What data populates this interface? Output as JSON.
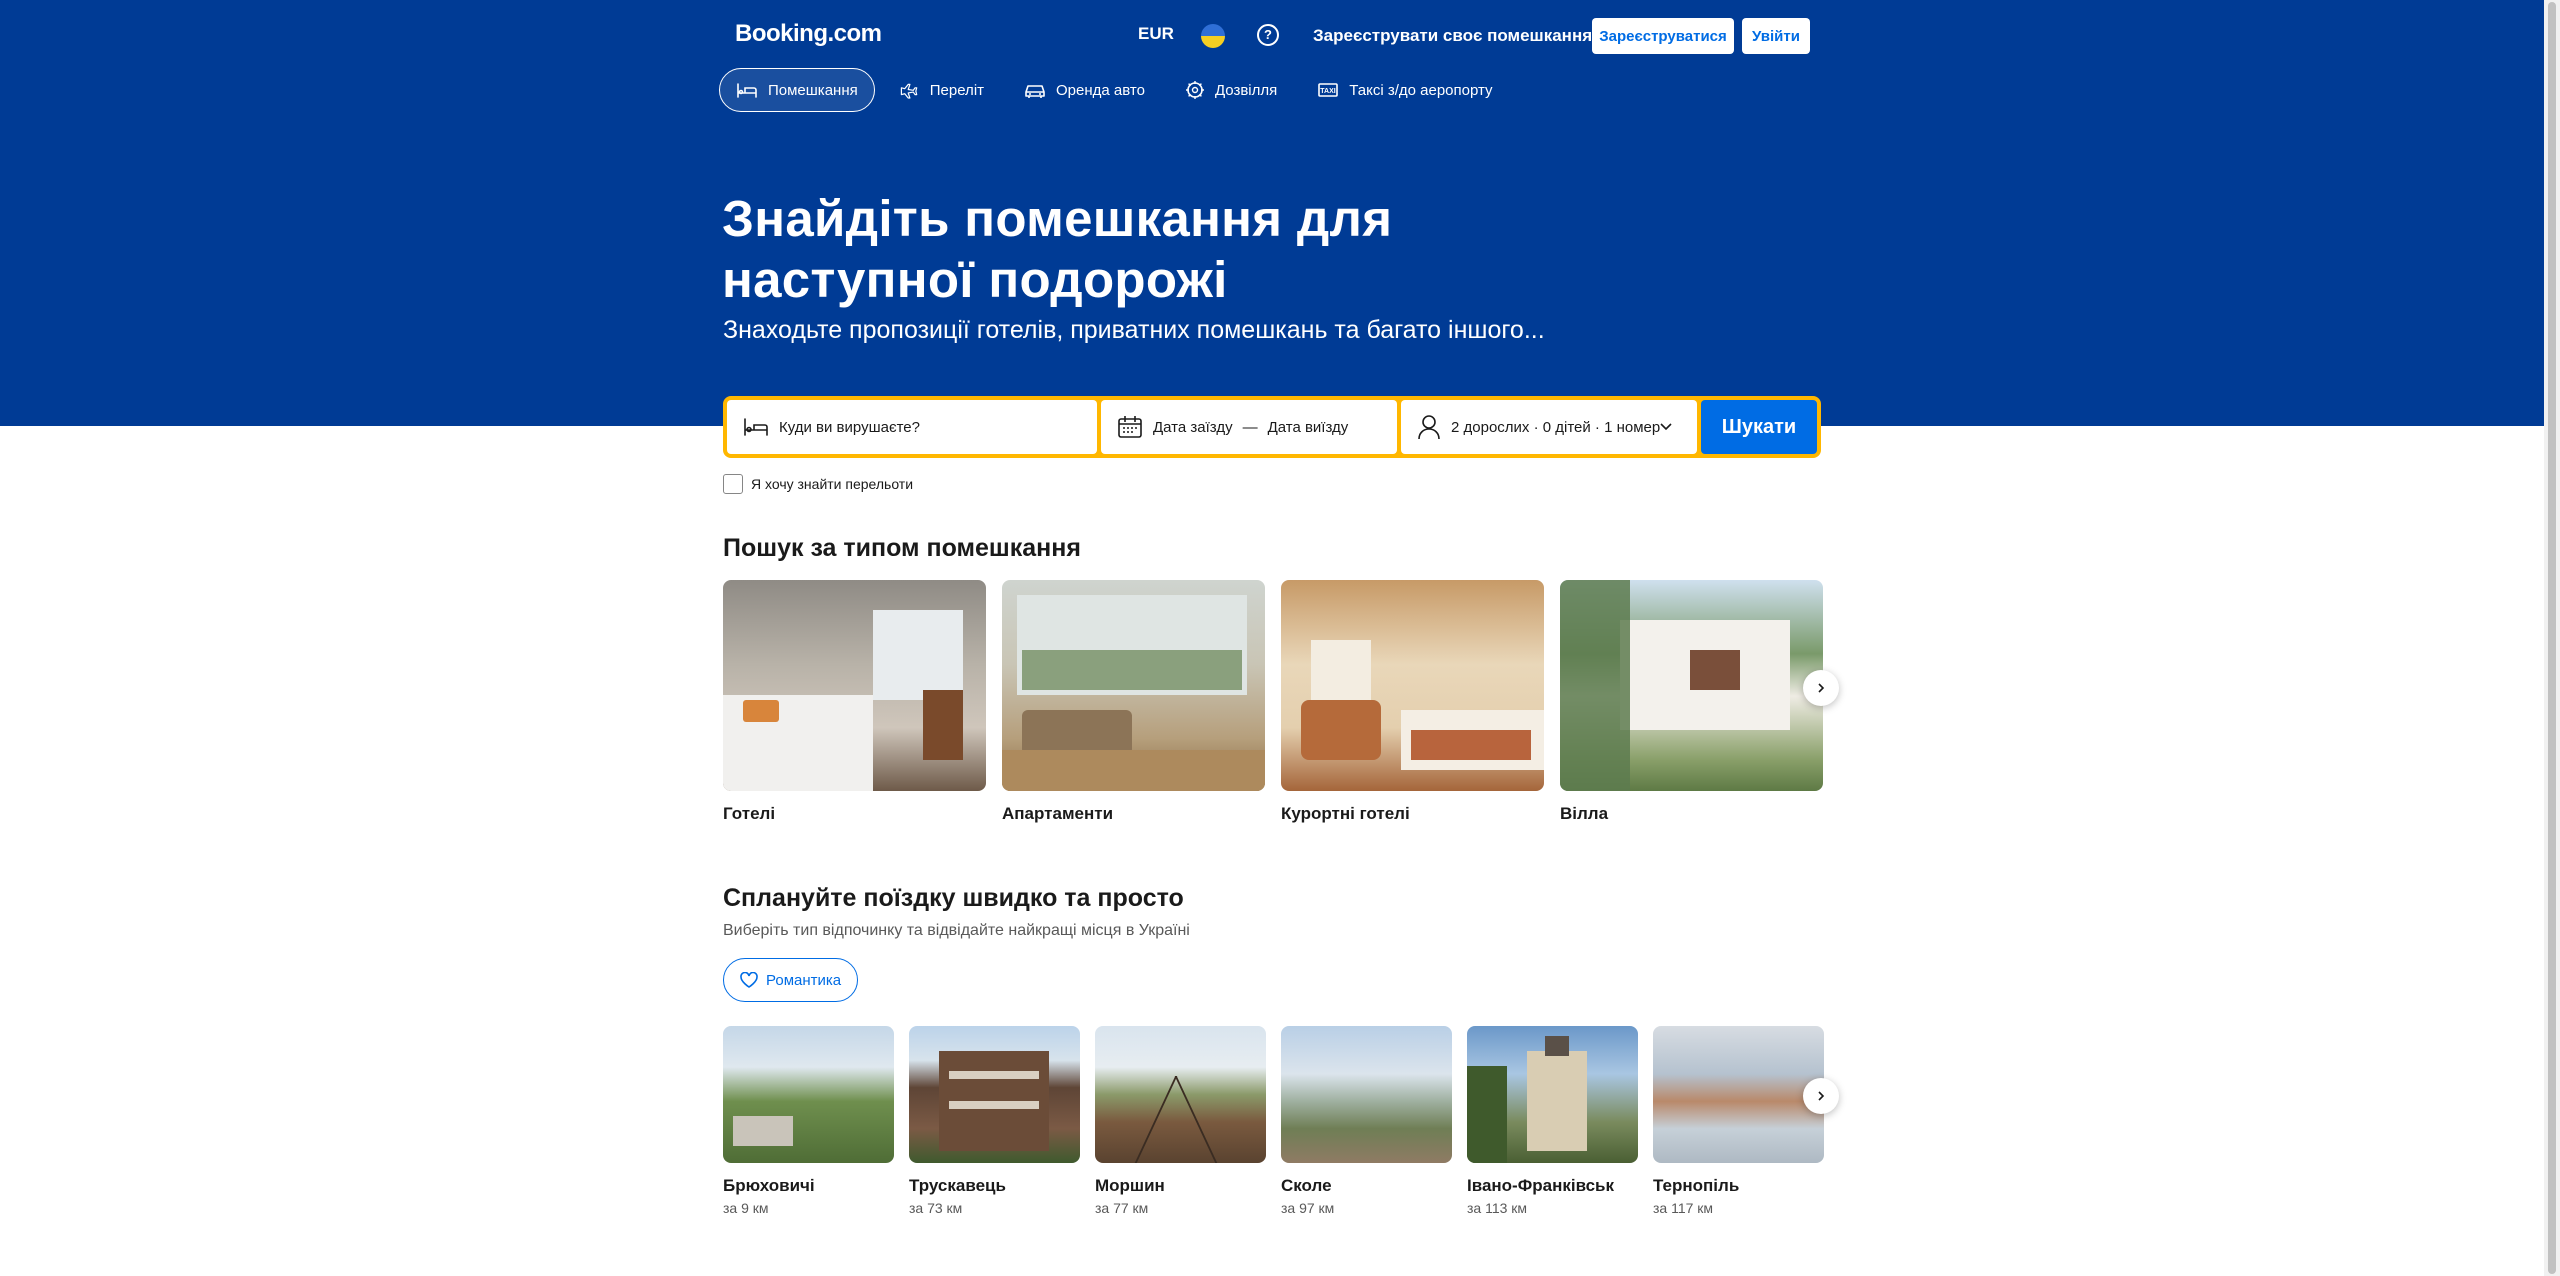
{
  "header": {
    "logo": "Booking.com",
    "currency": "EUR",
    "list_property": "Зареєструвати своє помешкання",
    "register": "Зареєструватися",
    "login": "Увійти"
  },
  "nav": [
    {
      "label": "Помешкання",
      "icon": "bed-icon",
      "active": true
    },
    {
      "label": "Переліт",
      "icon": "plane-icon",
      "active": false
    },
    {
      "label": "Оренда авто",
      "icon": "car-icon",
      "active": false
    },
    {
      "label": "Дозвілля",
      "icon": "attractions-icon",
      "active": false
    },
    {
      "label": "Таксі з/до аеропорту",
      "icon": "taxi-icon",
      "active": false
    }
  ],
  "hero": {
    "title": "Знайдіть помешкання для наступної подорожі",
    "subtitle": "Знаходьте пропозиції готелів, приватних помешкань та багато іншого..."
  },
  "search": {
    "destination_placeholder": "Куди ви вирушаєте?",
    "checkin": "Дата заїзду",
    "separator": "—",
    "checkout": "Дата виїзду",
    "guests": "2 дорослих · 0 дітей · 1 номер",
    "button": "Шукати",
    "flights_checkbox": "Я хочу знайти перельоти"
  },
  "property_types": {
    "title": "Пошук за типом помешкання",
    "items": [
      {
        "label": "Готелі"
      },
      {
        "label": "Апартаменти"
      },
      {
        "label": "Курортні готелі"
      },
      {
        "label": "Вілла"
      }
    ]
  },
  "trip_planner": {
    "title": "Сплануйте поїздку швидко та просто",
    "subtitle": "Виберіть тип відпочинку та відвідайте найкращі місця в Україні",
    "chip": "Романтика",
    "cities": [
      {
        "name": "Брюховичі",
        "distance": "за 9 км"
      },
      {
        "name": "Трускавець",
        "distance": "за 73 км"
      },
      {
        "name": "Моршин",
        "distance": "за 77 км"
      },
      {
        "name": "Сколе",
        "distance": "за 97 км"
      },
      {
        "name": "Івано-Франківськ",
        "distance": "за 113 км"
      },
      {
        "name": "Тернопіль",
        "distance": "за 117 км"
      }
    ]
  },
  "colors": {
    "brand_blue": "#003b95",
    "action_blue": "#006ce4",
    "search_border": "#ffb700"
  }
}
